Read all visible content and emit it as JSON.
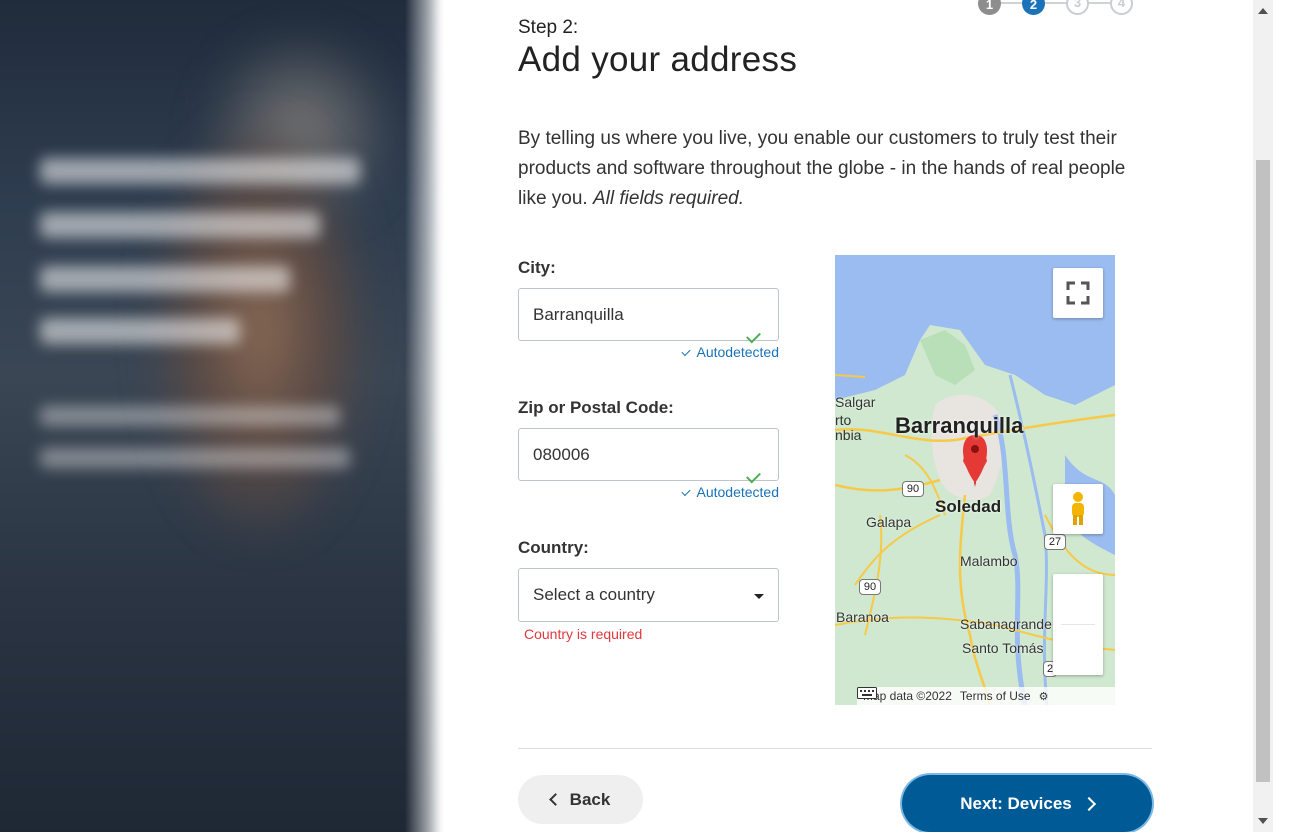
{
  "header": {
    "step_label": "Step 2:",
    "title": "Add your address",
    "steps": [
      {
        "label": "1",
        "state": "done"
      },
      {
        "label": "2",
        "state": "current"
      },
      {
        "label": "3",
        "state": "upcoming"
      },
      {
        "label": "4",
        "state": "upcoming"
      }
    ]
  },
  "intro": {
    "text": "By telling us where you live, you enable our customers to truly test their products and software throughout the globe - in the hands of real people like you.",
    "emphasis": "All fields required."
  },
  "form": {
    "city": {
      "label": "City:",
      "value": "Barranquilla",
      "hint": "Autodetected"
    },
    "zip": {
      "label": "Zip or Postal Code:",
      "value": "080006",
      "hint": "Autodetected"
    },
    "country": {
      "label": "Country:",
      "value": "Select a country",
      "error": "Country is required"
    }
  },
  "map": {
    "places": {
      "barranquilla": "Barranquilla",
      "soledad": "Soledad",
      "galapa": "Galapa",
      "malambo": "Malambo",
      "baranoa": "Baranoa",
      "sabanagrande": "Sabanagrande",
      "santo_tomas": "Santo Tomás",
      "salgar": "Salgar",
      "puerto_colombia_a": "rto",
      "puerto_colombia_b": "nbia"
    },
    "route_labels": {
      "r90a": "90",
      "r90b": "90",
      "r27": "27",
      "r2": "2"
    },
    "footer": {
      "data": "Map data ©2022",
      "terms": "Terms of Use"
    },
    "colors": {
      "water": "#9bbcf0",
      "land": "#cfe8cf",
      "urban": "#e8e4e0",
      "road": "#f7c948",
      "pin": "#e53935"
    }
  },
  "actions": {
    "back": "Back",
    "next": "Next: Devices"
  },
  "colors": {
    "primary": "#005a96",
    "link": "#1a73b8",
    "error": "#e0393e",
    "success": "#4caf50"
  }
}
